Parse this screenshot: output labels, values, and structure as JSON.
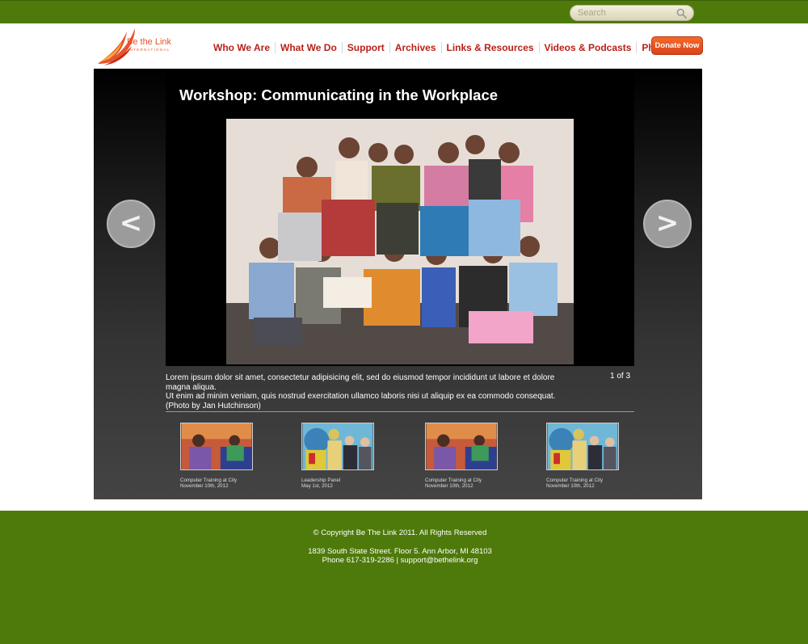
{
  "search": {
    "placeholder": "Search"
  },
  "logo": {
    "name": "Be the Link",
    "sub": "INTERNATIONAL"
  },
  "nav": {
    "items": [
      "Who We Are",
      "What We Do",
      "Support",
      "Archives",
      "Links & Resources",
      "Videos & Podcasts",
      "Photos"
    ]
  },
  "donate_label": "Donate Now",
  "slideshow": {
    "title": "Workshop: Communicating in the Workplace",
    "prev_label": "<",
    "next_label": ">",
    "caption_line1": "Lorem ipsum dolor sit amet, consectetur adipisicing elit, sed do eiusmod tempor incididunt ut labore et dolore magna aliqua.",
    "caption_line2": "Ut enim ad minim veniam, quis nostrud exercitation ullamco laboris nisi ut aliquip ex ea commodo consequat.",
    "caption_credit": "(Photo by Jan Hutchinson)",
    "counter": "1 of 3"
  },
  "thumbnails": [
    {
      "title": "Computer Training at City",
      "date": "November 10th, 2012"
    },
    {
      "title": "Leadership Panel",
      "date": "May 1st, 2012"
    },
    {
      "title": "Computer Training at City",
      "date": "November 10th, 2012"
    },
    {
      "title": "Computer Training at City",
      "date": "November 10th, 2012"
    }
  ],
  "footer": {
    "copyright": "© Copyright Be The Link 2011. All Rights Reserved",
    "address": "1839 South State Street. Floor 5. Ann Arbor, MI 48103",
    "contact": "Phone 617-319-2286 | support@bethelink.org"
  },
  "colors": {
    "brand_green": "#4e7a0b",
    "nav_red": "#b8211a",
    "donate_orange": "#e8531f"
  }
}
